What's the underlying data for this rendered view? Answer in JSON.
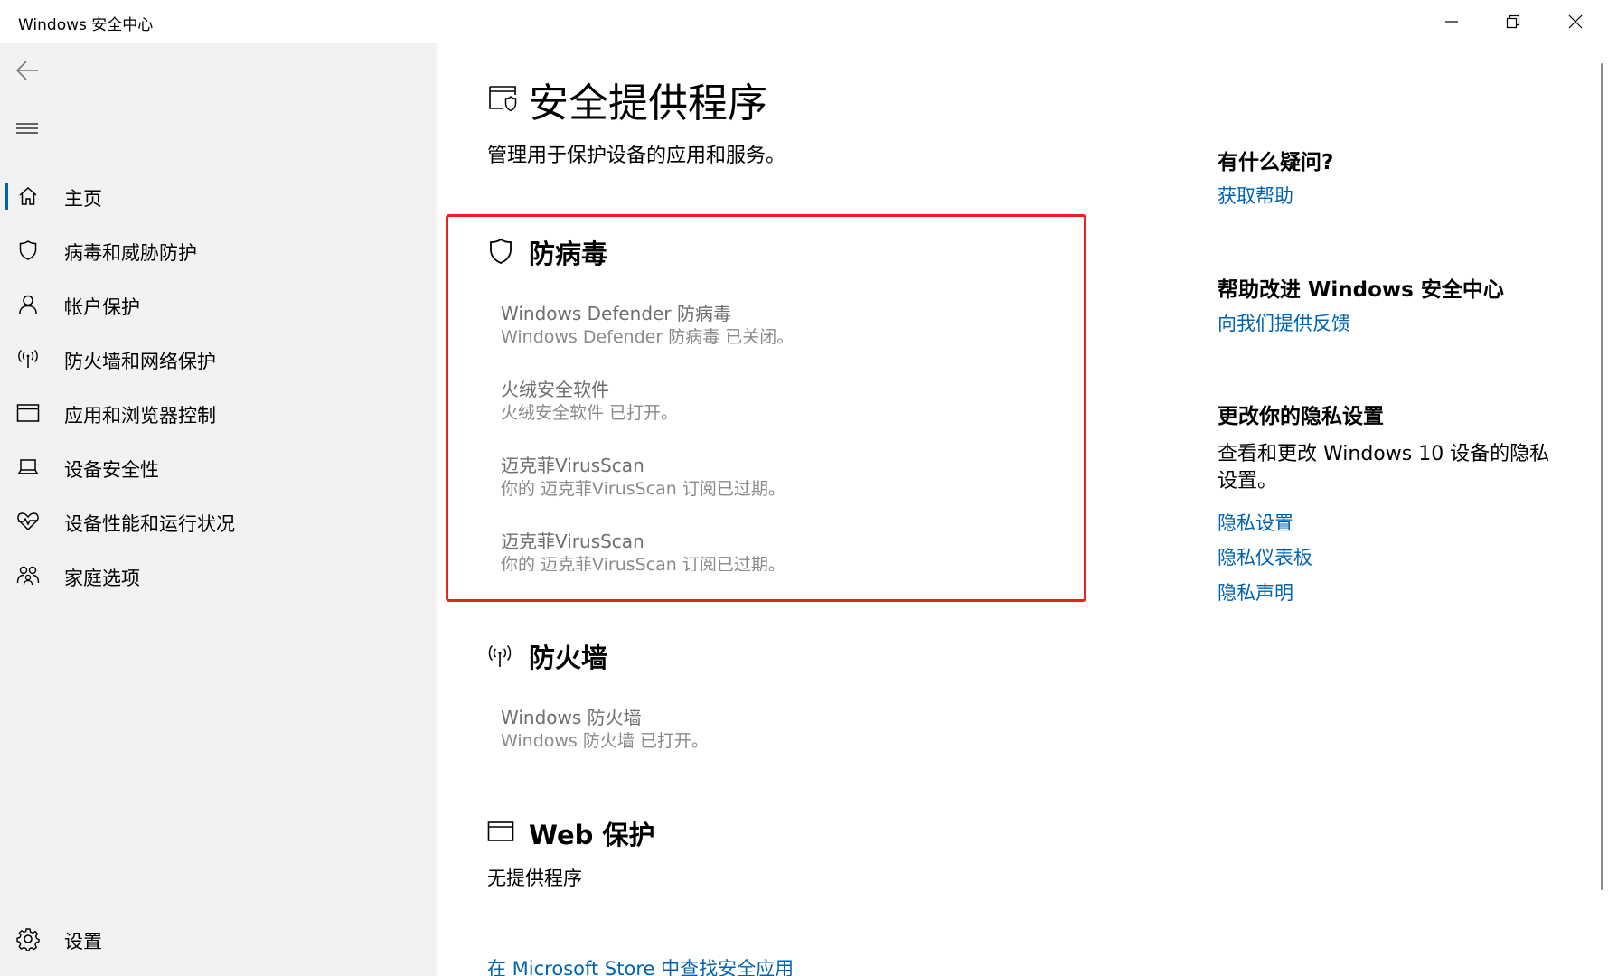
{
  "window": {
    "title": "Windows 安全中心"
  },
  "sidebar": {
    "items": [
      {
        "label": "主页",
        "icon": "home-icon",
        "active": true
      },
      {
        "label": "病毒和威胁防护",
        "icon": "shield-icon"
      },
      {
        "label": "帐户保护",
        "icon": "person-icon"
      },
      {
        "label": "防火墙和网络保护",
        "icon": "wireless-icon"
      },
      {
        "label": "应用和浏览器控制",
        "icon": "app-window-icon"
      },
      {
        "label": "设备安全性",
        "icon": "laptop-icon"
      },
      {
        "label": "设备性能和运行状况",
        "icon": "heart-pulse-icon"
      },
      {
        "label": "家庭选项",
        "icon": "family-icon"
      }
    ],
    "settings_label": "设置"
  },
  "main": {
    "title": "安全提供程序",
    "subtitle": "管理用于保护设备的应用和服务。",
    "antivirus": {
      "title": "防病毒",
      "providers": [
        {
          "name": "Windows Defender 防病毒",
          "status": "Windows Defender 防病毒 已关闭。"
        },
        {
          "name": "火绒安全软件",
          "status": "火绒安全软件 已打开。"
        },
        {
          "name": "迈克菲VirusScan",
          "status": "你的 迈克菲VirusScan 订阅已过期。"
        },
        {
          "name": "迈克菲VirusScan",
          "status": "你的 迈克菲VirusScan 订阅已过期。"
        }
      ]
    },
    "firewall": {
      "title": "防火墙",
      "providers": [
        {
          "name": "Windows 防火墙",
          "status": "Windows 防火墙 已打开。"
        }
      ]
    },
    "web": {
      "title": "Web 保护",
      "none_text": "无提供程序"
    },
    "store_link": "在 Microsoft Store 中查找安全应用"
  },
  "right": {
    "question_heading": "有什么疑问?",
    "get_help": "获取帮助",
    "improve_heading": "帮助改进 Windows 安全中心",
    "feedback_link": "向我们提供反馈",
    "privacy_heading": "更改你的隐私设置",
    "privacy_text": "查看和更改 Windows 10 设备的隐私设置。",
    "privacy_links": [
      "隐私设置",
      "隐私仪表板",
      "隐私声明"
    ]
  },
  "colors": {
    "accent": "#0063b1",
    "highlight": "#e8231d",
    "sidebar_bg": "#f2f2f2"
  }
}
